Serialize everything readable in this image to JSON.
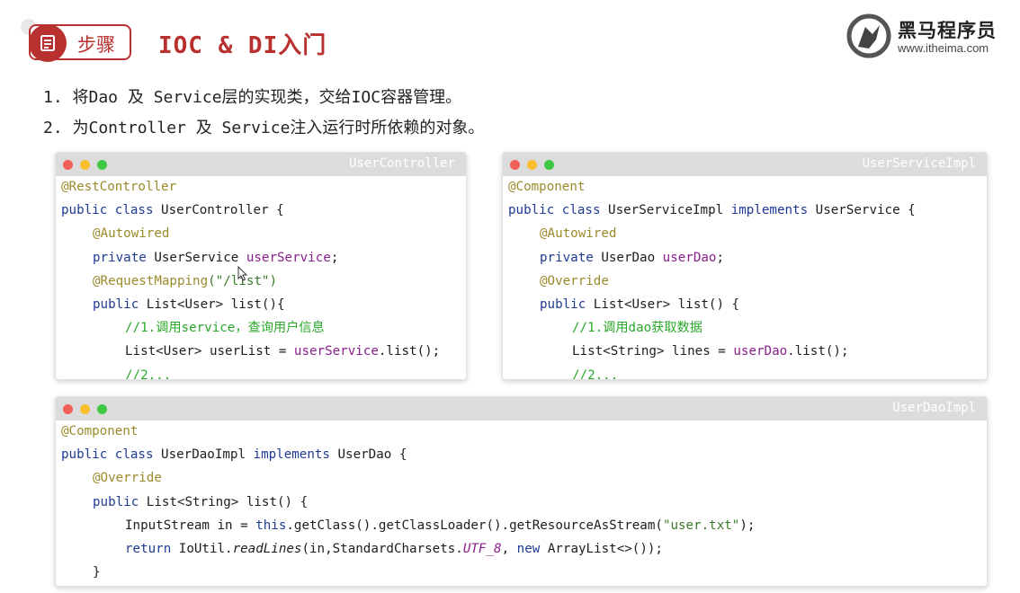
{
  "header": {
    "step_label": "步骤",
    "title": "IOC & DI入门",
    "brand_name": "黑马程序员",
    "brand_url": "www.itheima.com"
  },
  "steps": [
    "1. 将Dao 及 Service层的实现类，交给IOC容器管理。",
    "2. 为Controller 及 Service注入运行时所依赖的对象。"
  ],
  "windows": {
    "controller": {
      "title": "UserController",
      "ann_rest": "@RestController",
      "l2_kw": "public class",
      "l2_rest": " UserController {",
      "ann_autowired": "@Autowired",
      "l4_kw": "private",
      "l4_type": " UserService ",
      "l4_field": "userService",
      "l4_end": ";",
      "ann_mapping": "@RequestMapping",
      "l5_str": "(\"/list\")",
      "l6_kw": "public",
      "l6_rest": " List<User> list(){",
      "comment1": "//1.调用service，查询用户信息",
      "l8_pre": "List<User> userList = ",
      "l8_field": "userService",
      "l8_end": ".list();",
      "comment2": "//2..."
    },
    "service": {
      "title": "UserServiceImpl",
      "ann_component": "@Component",
      "l2_kw": "public class",
      "l2_mid": " UserServiceImpl ",
      "l2_kw2": "implements",
      "l2_end": " UserService {",
      "ann_autowired": "@Autowired",
      "l4_kw": "private",
      "l4_type": " UserDao ",
      "l4_field": "userDao",
      "l4_end": ";",
      "ann_override": "@Override",
      "l6_kw": "public",
      "l6_rest": " List<User> list() {",
      "comment1": "//1.调用dao获取数据",
      "l8_pre": "List<String> lines = ",
      "l8_field": "userDao",
      "l8_end": ".list();",
      "comment2": "//2..."
    },
    "dao": {
      "title": "UserDaoImpl",
      "ann_component": "@Component",
      "l2_kw": "public class",
      "l2_mid": " UserDaoImpl ",
      "l2_kw2": "implements",
      "l2_end": " UserDao {",
      "ann_override": "@Override",
      "l4_kw": "public",
      "l4_rest": " List<String> list() {",
      "l5_pre": "InputStream in = ",
      "l5_kw": "this",
      "l5_mid": ".getClass().getClassLoader().getResourceAsStream(",
      "l5_str": "\"user.txt\"",
      "l5_end": ");",
      "l6_kw": "return",
      "l6_pre": " IoUtil.",
      "l6_method": "readLines",
      "l6_mid": "(in,StandardCharsets.",
      "l6_const": "UTF_8",
      "l6_comma": ", ",
      "l6_kw2": "new",
      "l6_end": " ArrayList<>());",
      "l7": "}"
    }
  },
  "colors": {
    "accent": "#b8312f",
    "keyword": "#1f3a93",
    "annotation": "#9b8a2a",
    "field": "#8a1f8c",
    "comment": "#2aa82a",
    "string": "#3a7a2a"
  },
  "icons": {
    "step": "document-icon",
    "brand": "horse-logo-icon"
  }
}
